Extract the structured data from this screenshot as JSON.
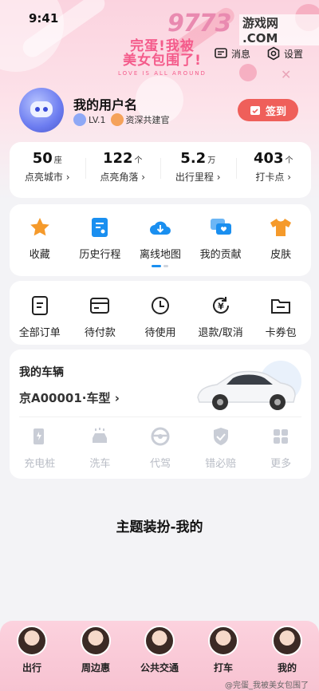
{
  "status_bar": {
    "time": "9:41"
  },
  "banner": {
    "line1": "完蛋!我被",
    "line2": "美女包围了!",
    "slogan": "LOVE IS ALL AROUND"
  },
  "watermark": {
    "logo": "9773",
    "site": "游戏网 .COM",
    "bottom": "@完蛋_我被美女包围了"
  },
  "header_actions": {
    "message": "消息",
    "settings": "设置"
  },
  "profile": {
    "name": "我的用户名",
    "level": "LV.1",
    "title": "资深共建官",
    "signin": "签到"
  },
  "stats": [
    {
      "value": "50",
      "unit": "座",
      "label": "点亮城市"
    },
    {
      "value": "122",
      "unit": "个",
      "label": "点亮角落"
    },
    {
      "value": "5.2",
      "unit": "万",
      "label": "出行里程"
    },
    {
      "value": "403",
      "unit": "个",
      "label": "打卡点"
    }
  ],
  "quick_grid": [
    {
      "label": "收藏",
      "icon": "star-icon"
    },
    {
      "label": "历史行程",
      "icon": "history-trip-icon"
    },
    {
      "label": "离线地图",
      "icon": "cloud-download-icon"
    },
    {
      "label": "我的贡献",
      "icon": "contribution-icon"
    },
    {
      "label": "皮肤",
      "icon": "tshirt-icon"
    }
  ],
  "orders": [
    {
      "label": "全部订单",
      "icon": "order-list-icon"
    },
    {
      "label": "待付款",
      "icon": "card-icon"
    },
    {
      "label": "待使用",
      "icon": "clock-icon"
    },
    {
      "label": "退款/取消",
      "icon": "refund-icon"
    },
    {
      "label": "卡券包",
      "icon": "coupon-icon"
    }
  ],
  "vehicle": {
    "title": "我的车辆",
    "plate": "京A00001·车型",
    "services": [
      {
        "label": "充电桩",
        "icon": "charging-pile-icon"
      },
      {
        "label": "洗车",
        "icon": "car-wash-icon"
      },
      {
        "label": "代驾",
        "icon": "steering-wheel-icon"
      },
      {
        "label": "错必赔",
        "icon": "shield-check-icon"
      },
      {
        "label": "更多",
        "icon": "grid-more-icon"
      }
    ]
  },
  "theme_title": "主题装扮-我的",
  "tabs": [
    "出行",
    "周边惠",
    "公共交通",
    "打车",
    "我的"
  ],
  "colors": {
    "accent_red": "#ef5f5a",
    "pink": "#f45b8b",
    "orange": "#f59a2b",
    "blue": "#1a8ff0"
  }
}
